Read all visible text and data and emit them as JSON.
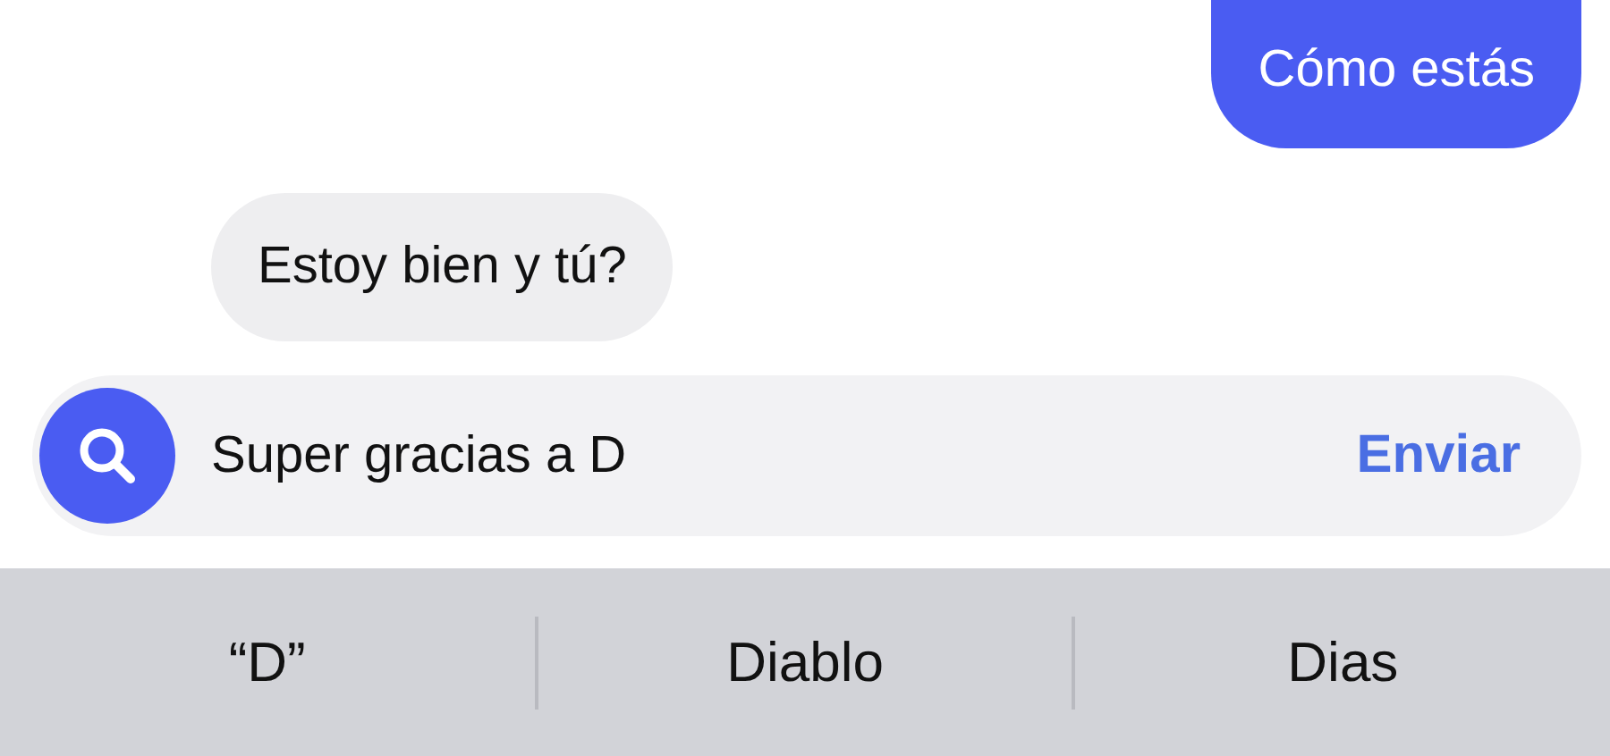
{
  "messages": [
    {
      "kind": "outgoing",
      "text": "Cómo estás"
    },
    {
      "kind": "incoming",
      "text": "Estoy bien y tú?"
    }
  ],
  "composer": {
    "value": "Super gracias a D",
    "send": "Enviar"
  },
  "suggestions": [
    "“D”",
    "Diablo",
    "Dias"
  ]
}
